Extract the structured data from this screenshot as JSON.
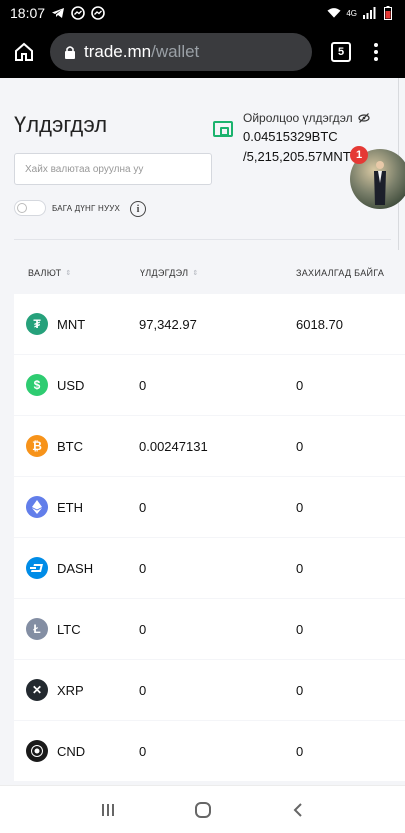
{
  "status_bar": {
    "time": "18:07",
    "network": "4G",
    "icons": [
      "telegram-icon",
      "messenger-icon",
      "messenger-icon",
      "wifi-icon",
      "signal-icon",
      "battery-icon"
    ]
  },
  "browser": {
    "domain": "trade.mn",
    "path": "/wallet",
    "tab_count": "5"
  },
  "page": {
    "title": "Үлдэгдэл",
    "approx_label": "Ойролцоо үлдэгдэл",
    "approx_btc": "0.04515329BTC",
    "approx_mnt": "/5,215,205.57MNT",
    "notification_count": "1",
    "search_placeholder": "Хайх валютаа оруулна уу",
    "toggle_label": "БАГА ДҮНГ НУУХ",
    "info_symbol": "i"
  },
  "table": {
    "headers": [
      "ВАЛЮТ",
      "ҮЛДЭГДЭЛ",
      "ЗАХИАЛГАД БАЙГА"
    ],
    "rows": [
      {
        "currency": "MNT",
        "balance": "97,342.97",
        "in_orders": "6018.70",
        "icon": "tether-icon",
        "color": "#26a17b"
      },
      {
        "currency": "USD",
        "balance": "0",
        "in_orders": "0",
        "icon": "dollar-icon",
        "color": "#2ecc71"
      },
      {
        "currency": "BTC",
        "balance": "0.00247131",
        "in_orders": "0",
        "icon": "bitcoin-icon",
        "color": "#f7931a"
      },
      {
        "currency": "ETH",
        "balance": "0",
        "in_orders": "0",
        "icon": "ethereum-icon",
        "color": "#627eea"
      },
      {
        "currency": "DASH",
        "balance": "0",
        "in_orders": "0",
        "icon": "dash-icon",
        "color": "#008ce7"
      },
      {
        "currency": "LTC",
        "balance": "0",
        "in_orders": "0",
        "icon": "litecoin-icon",
        "color": "#838ea3"
      },
      {
        "currency": "XRP",
        "balance": "0",
        "in_orders": "0",
        "icon": "xrp-icon",
        "color": "#23292f"
      },
      {
        "currency": "CND",
        "balance": "0",
        "in_orders": "0",
        "icon": "cindicator-icon",
        "color": "#1a1a1a"
      }
    ]
  },
  "colors": {
    "accent_green": "#1bb36e",
    "badge_red": "#e53935"
  }
}
